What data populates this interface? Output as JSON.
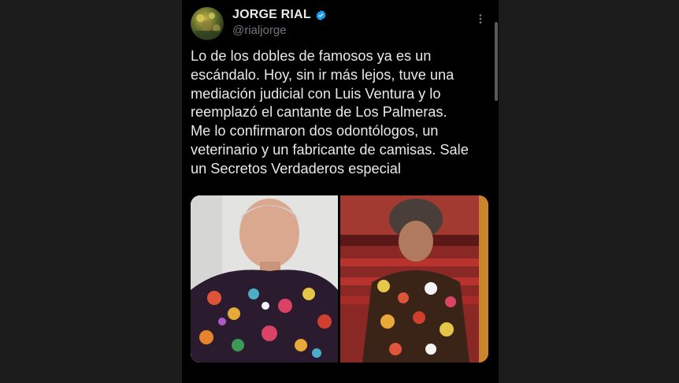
{
  "tweet": {
    "author_name": "JORGE RIAL",
    "handle": "@rialjorge",
    "text": "Lo de los dobles de famosos ya es un\nescándalo. Hoy, sin ir más lejos, tuve una\nmediación judicial con Luis Ventura y lo\nreemplazó el cantante de Los Palmeras.\nMe lo confirmaron dos odontólogos, un\nveterinario y un fabricante de camisas. Sale\nun Secretos Verdaderos especial",
    "verified": true,
    "media_count": 2
  },
  "icons": {
    "verified": "verified-badge-icon",
    "more": "more-options-icon"
  },
  "colors": {
    "background": "#000000",
    "side_panels": "#1c1c1c",
    "text_primary": "#e7e9ea",
    "text_secondary": "#71767b",
    "verified_blue": "#1d9bf0"
  }
}
